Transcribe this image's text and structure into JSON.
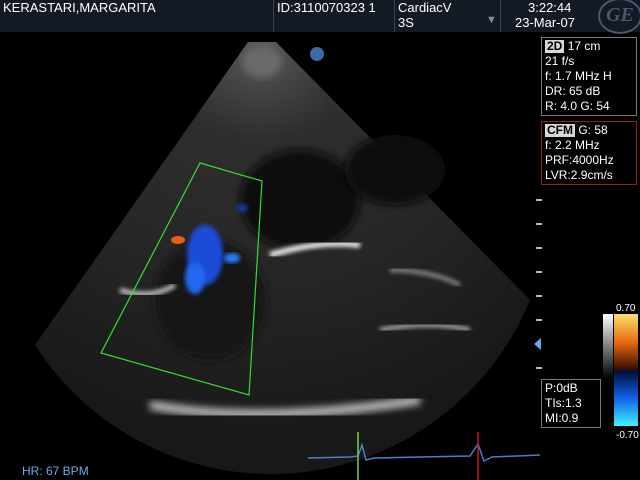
{
  "header": {
    "patient_name": "KERASTARI,MARGARITA",
    "patient_id": "ID:3110070323 1",
    "preset": "CardiacV",
    "probe": "3S",
    "dropdown_glyph": "▼",
    "time": "3:22:44",
    "date": "23-Mar-07",
    "logo_text": "GE"
  },
  "params_2d": {
    "mode_tag": "2D",
    "depth": "17 cm",
    "rows": [
      "21 f/s",
      "f: 1.7 MHz H",
      "DR: 65 dB",
      "R: 4.0   G: 54"
    ]
  },
  "params_cfm": {
    "mode_tag": "CFM",
    "gain": "G: 58",
    "rows": [
      "f: 2.2 MHz",
      "PRF:4000Hz",
      "LVR:2.9cm/s"
    ]
  },
  "indices": {
    "rows": [
      "P:0dB",
      "TIs:1.3",
      "MI:0.9"
    ]
  },
  "color_scale": {
    "top": "0.70",
    "bottom": "-0.70"
  },
  "heart_rate": "HR: 67 BPM",
  "colors": {
    "header_bg": "#141a24",
    "panel_border": "#7a7a7a",
    "cfm_border": "#9a2020",
    "roi_box": "#33dd33",
    "ecg_trace": "#4a80c8",
    "hr_text": "#6fa8e8",
    "focus_marker": "#3a6aa8"
  },
  "icons": [
    "ge-logo-icon",
    "dropdown-arrow-icon",
    "focus-marker-icon",
    "depth-pointer-icon"
  ]
}
